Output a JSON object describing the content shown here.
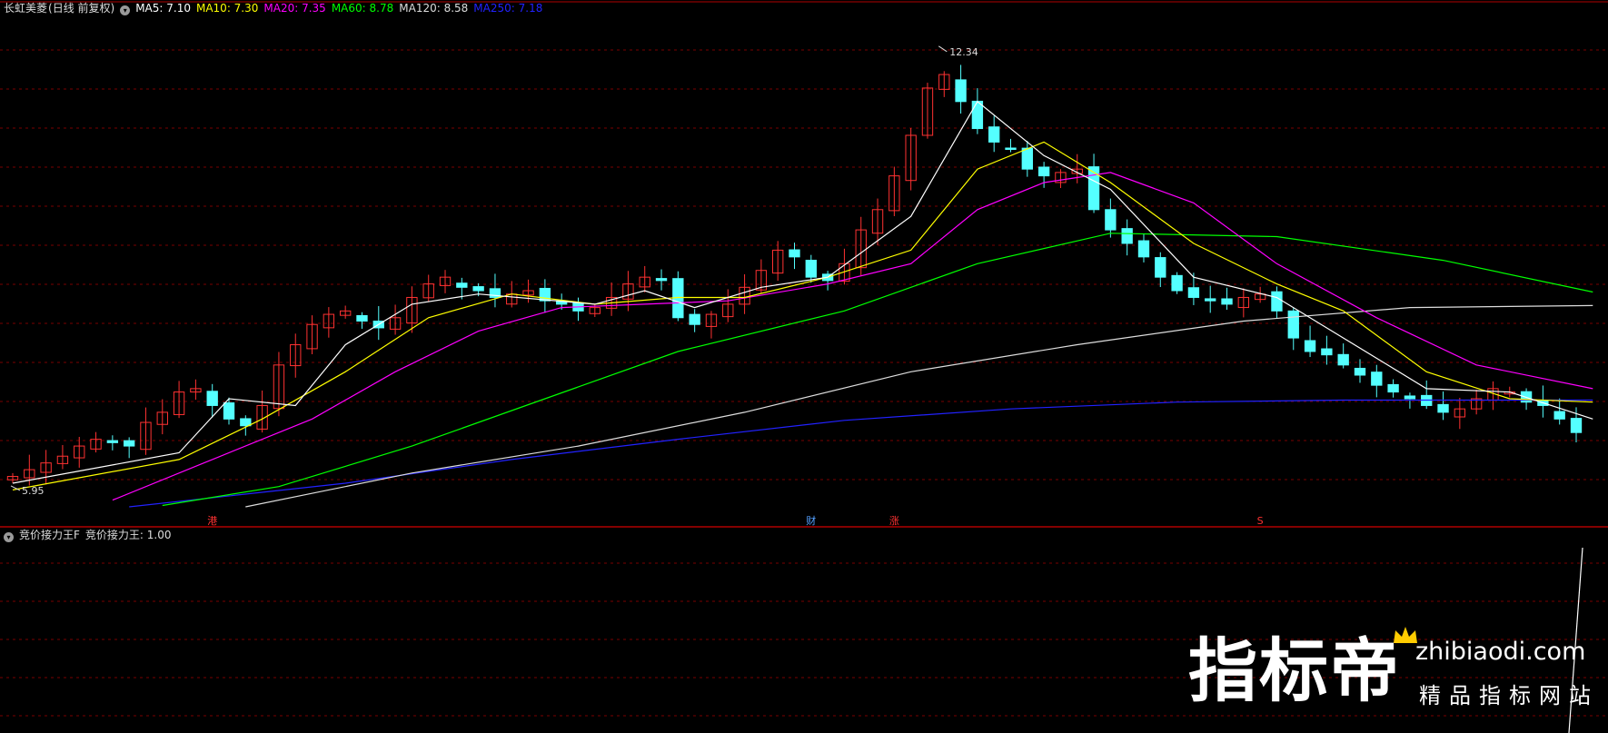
{
  "stock": {
    "name": "长虹美菱",
    "period": "(日线 前复权)"
  },
  "main_indicators": [
    {
      "label": "MA5: 7.10",
      "color": "#ffffff"
    },
    {
      "label": "MA10: 7.30",
      "color": "#ffff00"
    },
    {
      "label": "MA20: 7.35",
      "color": "#ff00ff"
    },
    {
      "label": "MA60: 8.78",
      "color": "#00ff00"
    },
    {
      "label": "MA120: 8.58",
      "color": "#dddddd"
    },
    {
      "label": "MA250: 7.18",
      "color": "#2222ff"
    }
  ],
  "sub_panel": {
    "name": "竞价接力王F",
    "value_label": "竞价接力王: 1.00"
  },
  "watermark": {
    "brand": "指标帝",
    "url": "zhibiaodi.com",
    "tagline": "精品指标网站"
  },
  "chart_data": {
    "type": "candlestick",
    "ylim": [
      5.6,
      12.7
    ],
    "y_scale": "linear",
    "grid": "horizontal dashed",
    "colors": {
      "up": "#ff3232",
      "down": "#54ffff",
      "ma5": "#ffffff",
      "ma10": "#ffff00",
      "ma20": "#ff00ff",
      "ma60": "#00ff00",
      "ma120": "#dddddd",
      "ma250": "#2222ff"
    },
    "annotations": [
      {
        "text": "12.34",
        "type": "high"
      },
      {
        "text": "5.95",
        "type": "low"
      }
    ],
    "event_markers": [
      {
        "text": "港",
        "color": "#ff3232"
      },
      {
        "text": "财",
        "color": "#54a0ff"
      },
      {
        "text": "涨",
        "color": "#ff3232"
      },
      {
        "text": "S",
        "color": "#ff3232"
      }
    ],
    "close_path": [
      6.05,
      6.15,
      6.25,
      6.35,
      6.5,
      6.6,
      6.55,
      6.5,
      6.85,
      7.0,
      7.3,
      7.35,
      7.1,
      6.9,
      6.8,
      7.1,
      7.7,
      8.0,
      8.3,
      8.45,
      8.5,
      8.35,
      8.25,
      8.4,
      8.7,
      8.9,
      9.0,
      8.85,
      8.8,
      8.7,
      8.75,
      8.8,
      8.65,
      8.6,
      8.5,
      8.55,
      8.7,
      8.9,
      9.0,
      8.95,
      8.4,
      8.3,
      8.45,
      8.6,
      8.85,
      9.1,
      9.4,
      9.3,
      9.0,
      8.95,
      9.2,
      9.7,
      10.0,
      10.5,
      11.1,
      11.8,
      12.0,
      11.6,
      11.2,
      11.0,
      10.9,
      10.6,
      10.5,
      10.55,
      10.6,
      10.0,
      9.7,
      9.5,
      9.3,
      9.0,
      8.8,
      8.7,
      8.65,
      8.6,
      8.7,
      8.75,
      8.5,
      8.1,
      7.9,
      7.85,
      7.7,
      7.55,
      7.4,
      7.3,
      7.2,
      7.1,
      7.0,
      7.05,
      7.2,
      7.35,
      7.3,
      7.15,
      7.1,
      6.9,
      6.7
    ],
    "ma_paths": {
      "ma5": [
        [
          0,
          5.95
        ],
        [
          10,
          6.4
        ],
        [
          13,
          7.2
        ],
        [
          17,
          7.1
        ],
        [
          20,
          8.0
        ],
        [
          24,
          8.6
        ],
        [
          28,
          8.75
        ],
        [
          35,
          8.6
        ],
        [
          38,
          8.8
        ],
        [
          41,
          8.55
        ],
        [
          45,
          8.85
        ],
        [
          49,
          9.0
        ],
        [
          54,
          9.9
        ],
        [
          58,
          11.6
        ],
        [
          62,
          10.8
        ],
        [
          66,
          10.3
        ],
        [
          71,
          9.0
        ],
        [
          76,
          8.7
        ],
        [
          80,
          8.1
        ],
        [
          85,
          7.35
        ],
        [
          90,
          7.3
        ],
        [
          95,
          6.9
        ]
      ],
      "ma10": [
        [
          0,
          5.85
        ],
        [
          10,
          6.3
        ],
        [
          15,
          6.9
        ],
        [
          20,
          7.6
        ],
        [
          25,
          8.4
        ],
        [
          30,
          8.75
        ],
        [
          35,
          8.6
        ],
        [
          40,
          8.7
        ],
        [
          44,
          8.7
        ],
        [
          49,
          9.0
        ],
        [
          54,
          9.4
        ],
        [
          58,
          10.6
        ],
        [
          62,
          11.0
        ],
        [
          66,
          10.4
        ],
        [
          71,
          9.5
        ],
        [
          76,
          8.9
        ],
        [
          80,
          8.5
        ],
        [
          85,
          7.6
        ],
        [
          90,
          7.2
        ],
        [
          95,
          7.15
        ]
      ],
      "ma20": [
        [
          6,
          5.7
        ],
        [
          12,
          6.3
        ],
        [
          18,
          6.9
        ],
        [
          23,
          7.6
        ],
        [
          28,
          8.2
        ],
        [
          33,
          8.55
        ],
        [
          38,
          8.6
        ],
        [
          43,
          8.65
        ],
        [
          49,
          8.9
        ],
        [
          54,
          9.2
        ],
        [
          58,
          10.0
        ],
        [
          62,
          10.4
        ],
        [
          66,
          10.55
        ],
        [
          71,
          10.1
        ],
        [
          76,
          9.2
        ],
        [
          82,
          8.4
        ],
        [
          88,
          7.7
        ],
        [
          95,
          7.35
        ]
      ],
      "ma60": [
        [
          9,
          5.62
        ],
        [
          16,
          5.9
        ],
        [
          24,
          6.5
        ],
        [
          32,
          7.2
        ],
        [
          40,
          7.9
        ],
        [
          50,
          8.5
        ],
        [
          58,
          9.2
        ],
        [
          66,
          9.65
        ],
        [
          76,
          9.6
        ],
        [
          86,
          9.25
        ],
        [
          95,
          8.78
        ]
      ],
      "ma120": [
        [
          14,
          5.6
        ],
        [
          24,
          6.1
        ],
        [
          34,
          6.5
        ],
        [
          44,
          7.0
        ],
        [
          54,
          7.6
        ],
        [
          64,
          8.0
        ],
        [
          74,
          8.35
        ],
        [
          84,
          8.55
        ],
        [
          95,
          8.58
        ]
      ],
      "ma250": [
        [
          7,
          5.6
        ],
        [
          20,
          5.95
        ],
        [
          30,
          6.3
        ],
        [
          40,
          6.6
        ],
        [
          50,
          6.88
        ],
        [
          60,
          7.05
        ],
        [
          70,
          7.15
        ],
        [
          80,
          7.18
        ],
        [
          95,
          7.18
        ]
      ]
    }
  }
}
